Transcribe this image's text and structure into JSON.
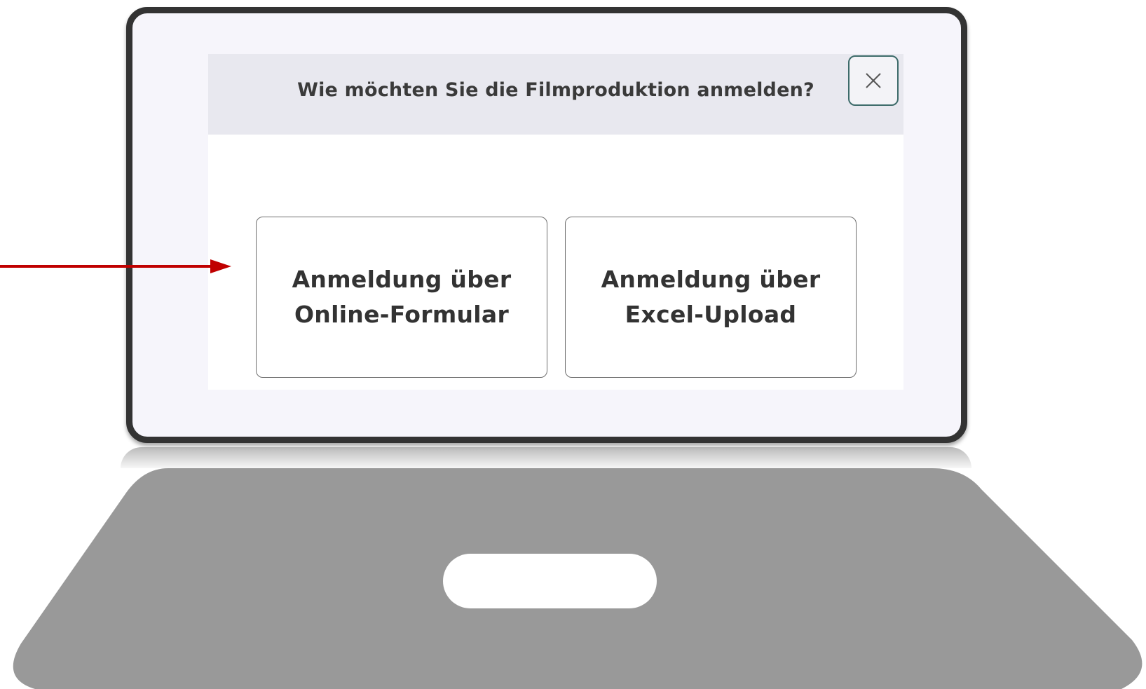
{
  "dialog": {
    "title": "Wie möchten Sie die Filmproduktion anmelden?",
    "close_icon": "close-icon",
    "options": [
      {
        "label_line1": "Anmeldung über",
        "label_line2": "Online-Formular"
      },
      {
        "label_line1": "Anmeldung über",
        "label_line2": "Excel-Upload"
      }
    ]
  },
  "colors": {
    "arrow": "#c00000",
    "close_border": "#3d6b6a",
    "header_bg": "#e8e8ef",
    "laptop_frame": "#333333",
    "laptop_base": "#999999"
  }
}
